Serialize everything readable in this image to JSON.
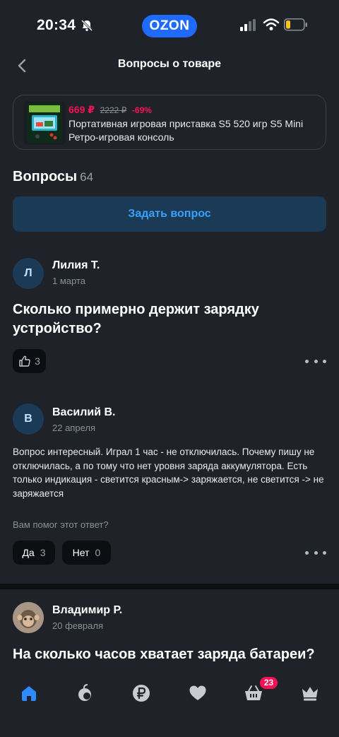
{
  "status_bar": {
    "time": "20:34",
    "brand": "OZON",
    "icons": [
      "bell-off-icon",
      "signal-icon",
      "wifi-icon",
      "battery-icon"
    ]
  },
  "header": {
    "title": "Вопросы о товаре",
    "back_icon": "chevron-left-icon"
  },
  "product": {
    "price": "669 ₽",
    "old_price": "2222 ₽",
    "discount": "-69%",
    "name": "Портативная игровая приставка S5 520 игр S5 Mini Ретро-игровая консоль"
  },
  "questions_section": {
    "title": "Вопросы",
    "count": "64",
    "ask_button": "Задать вопрос"
  },
  "question1": {
    "avatar_letter": "Л",
    "author": "Лилия Т.",
    "date": "1 марта",
    "text": "Сколько примерно держит зарядку устройство?",
    "likes": "3"
  },
  "answer1": {
    "avatar_letter": "В",
    "author": "Василий В.",
    "date": "22 апреля",
    "text": "Вопрос интересный. Играл 1 час - не отключилась. Почему пишу не отключилась, а по тому что нет уровня заряда аккумулятора. Есть только индикация - светится красным-> заряжается, не светится -> не заряжается",
    "helpful_question": "Вам помог этот ответ?",
    "yes_label": "Да",
    "yes_count": "3",
    "no_label": "Нет",
    "no_count": "0"
  },
  "question2": {
    "author": "Владимир Р.",
    "date": "20 февраля",
    "text": "На сколько часов хватает заряда батареи?"
  },
  "bottom_nav": {
    "items": [
      "home-icon",
      "fresh-icon",
      "ruble-icon",
      "heart-icon",
      "cart-icon",
      "crown-icon"
    ],
    "cart_badge": "23"
  },
  "colors": {
    "background": "#1f2329",
    "accent": "#3aa0ff",
    "price": "#f91155",
    "brand": "#1f6bff"
  }
}
